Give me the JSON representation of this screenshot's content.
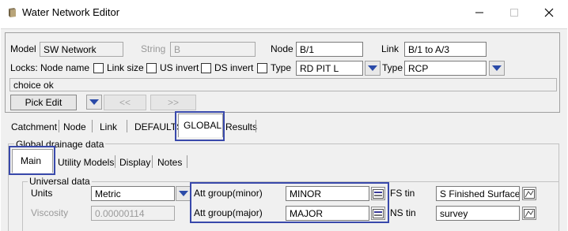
{
  "window": {
    "title": "Water Network Editor"
  },
  "top": {
    "model_label": "Model",
    "model_value": "SW Network",
    "string_label": "String",
    "string_value": "B",
    "node_label": "Node",
    "node_value": "B/1",
    "link_label": "Link",
    "link_value": "B/1 to A/3",
    "locks_label": "Locks:",
    "node_name_label": "Node name",
    "link_size_label": "Link size",
    "us_invert_label": "US invert",
    "ds_invert_label": "DS invert",
    "type_label": "Type",
    "type_value": "RD PIT L",
    "type2_label": "Type",
    "type2_value": "RCP",
    "message": "choice ok",
    "pick_edit_label": "Pick Edit",
    "prev_label": "<<",
    "next_label": ">>"
  },
  "tabs": [
    "Catchment",
    "Node",
    "Link",
    "DEFAULTS",
    "GLOBAL",
    "Results"
  ],
  "global": {
    "group_title": "Global drainage data",
    "subtabs": [
      "Main",
      "Utility Models",
      "Display",
      "Notes"
    ],
    "universal_title": "Universal data",
    "units_label": "Units",
    "units_value": "Metric",
    "viscosity_label": "Viscosity",
    "viscosity_value": "0.00000114",
    "att_minor_label": "Att group(minor)",
    "att_minor_value": "MINOR",
    "att_major_label": "Att group(major)",
    "att_major_value": "MAJOR",
    "fs_tin_label": "FS tin",
    "fs_tin_value": "S Finished Surface",
    "ns_tin_label": "NS tin",
    "ns_tin_value": "survey"
  },
  "colors": {
    "highlight": "#3949ab",
    "arrow": "#2a4aa8"
  }
}
